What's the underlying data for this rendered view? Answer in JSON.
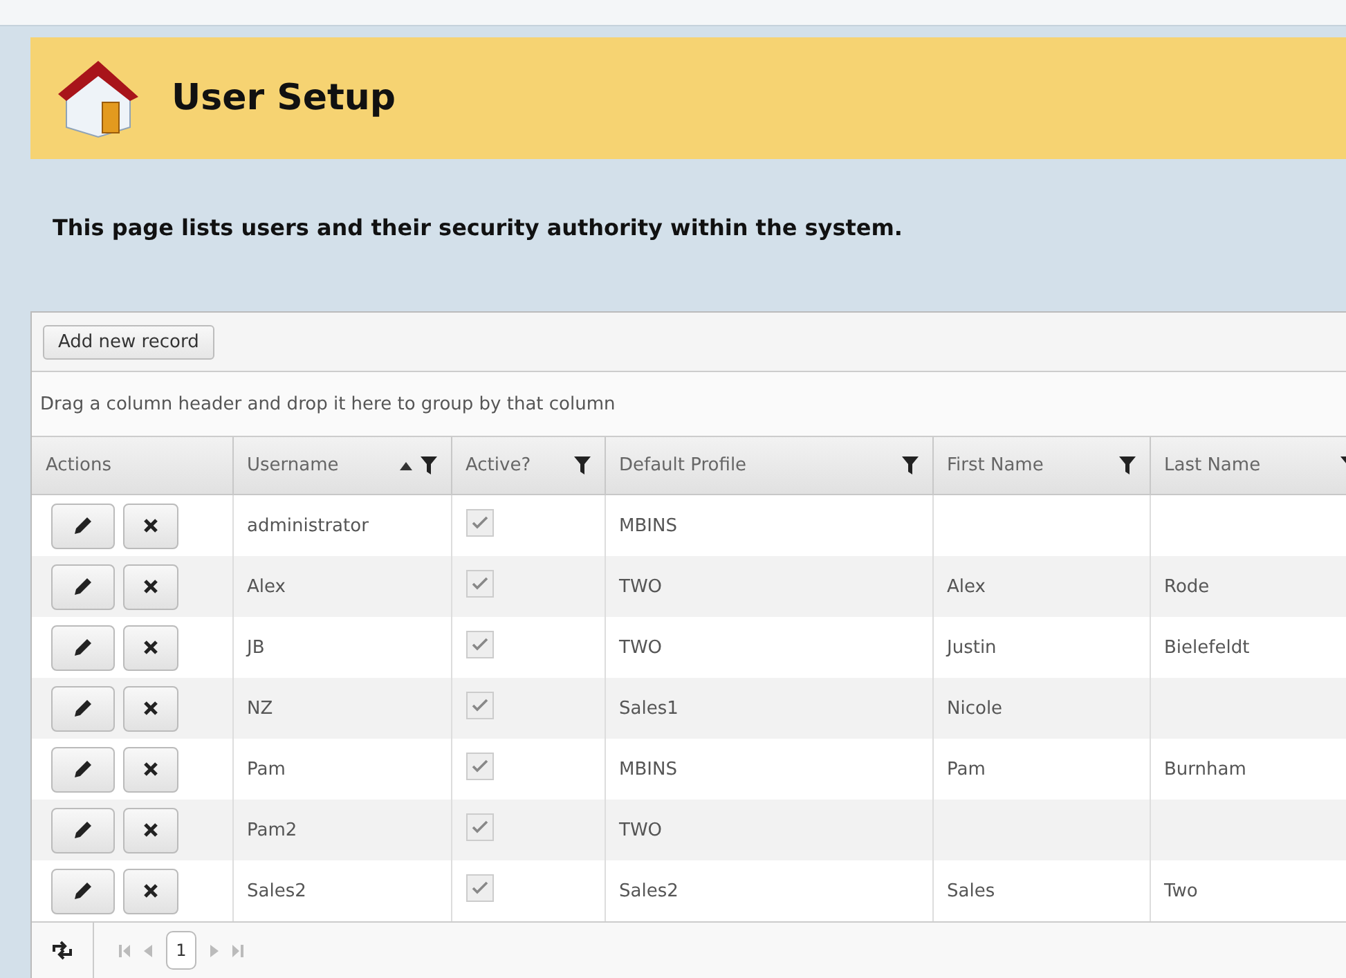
{
  "header": {
    "title": "User Setup"
  },
  "description": "This page lists users and their security authority within the system.",
  "toolbar": {
    "buttons": [
      "Add new record"
    ]
  },
  "group_panel": "Drag a column header and drop it here to group by that column",
  "table": {
    "columns": [
      {
        "label": "Actions",
        "sorted_ascending": false,
        "filterable": false
      },
      {
        "label": "Username",
        "sorted_ascending": true,
        "filterable": true
      },
      {
        "label": "Active?",
        "sorted_ascending": false,
        "filterable": true
      },
      {
        "label": "Default Profile",
        "sorted_ascending": false,
        "filterable": true
      },
      {
        "label": "First Name",
        "sorted_ascending": false,
        "filterable": true
      },
      {
        "label": "Last Name",
        "sorted_ascending": false,
        "filterable": true
      }
    ],
    "rows": [
      {
        "username": "administrator",
        "active": true,
        "profile": "MBINS"
      },
      {
        "username": "Alex",
        "active": true,
        "profile": "TWO",
        "first_name": "Alex",
        "last_name": "Rode"
      },
      {
        "username": "JB",
        "active": true,
        "profile": "TWO",
        "first_name": "Justin",
        "last_name": "Bielefeldt"
      },
      {
        "username": "NZ",
        "active": true,
        "profile": "Sales1",
        "first_name": "Nicole"
      },
      {
        "username": "Pam",
        "active": true,
        "profile": "MBINS",
        "first_name": "Pam",
        "last_name": "Burnham"
      },
      {
        "username": "Pam2",
        "active": true,
        "profile": "TWO"
      },
      {
        "username": "Sales2",
        "active": true,
        "profile": "Sales2",
        "first_name": "Sales",
        "last_name": "Two"
      }
    ]
  },
  "pager": {
    "pages": [
      {
        "label": "1",
        "selected": true
      }
    ]
  }
}
